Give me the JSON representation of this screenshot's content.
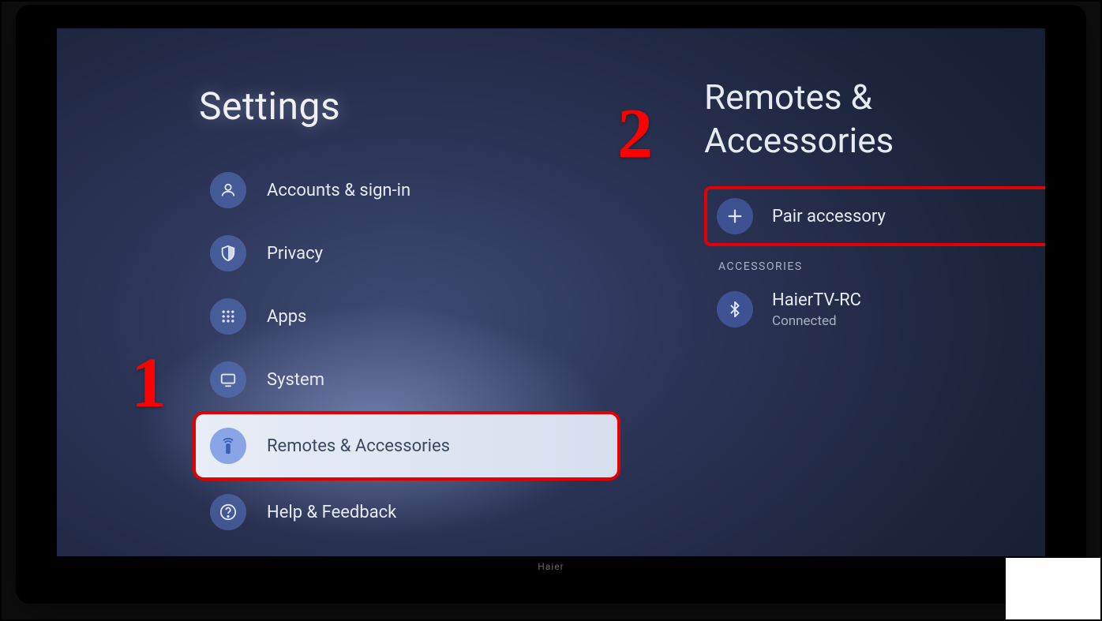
{
  "settings": {
    "title": "Settings",
    "items": [
      {
        "label": "Accounts & sign-in"
      },
      {
        "label": "Privacy"
      },
      {
        "label": "Apps"
      },
      {
        "label": "System"
      },
      {
        "label": "Remotes & Accessories"
      },
      {
        "label": "Help & Feedback"
      }
    ]
  },
  "right": {
    "title": "Remotes & Accessories",
    "pair_label": "Pair accessory",
    "section_header": "ACCESSORIES",
    "device": {
      "name": "HaierTV-RC",
      "status": "Connected"
    }
  },
  "annotations": {
    "one": "1",
    "two": "2"
  },
  "tv_brand": "Haier"
}
